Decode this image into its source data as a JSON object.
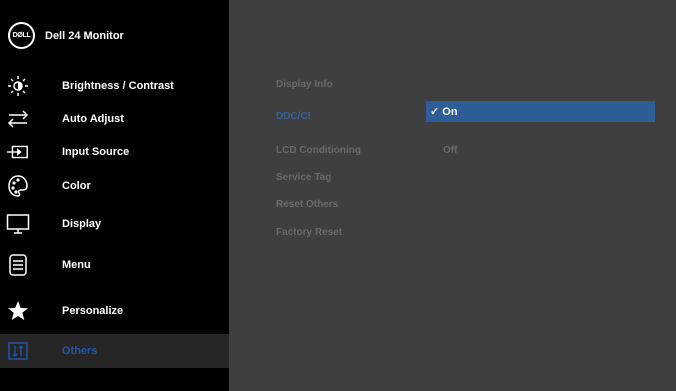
{
  "header": {
    "logo_text": "DØLL",
    "title": "Dell 24 Monitor"
  },
  "sidebar": {
    "items": [
      {
        "label": "Brightness / Contrast",
        "icon": "brightness-icon"
      },
      {
        "label": "Auto Adjust",
        "icon": "auto-adjust-icon"
      },
      {
        "label": "Input Source",
        "icon": "input-source-icon"
      },
      {
        "label": "Color",
        "icon": "color-palette-icon"
      },
      {
        "label": "Display",
        "icon": "display-icon"
      },
      {
        "label": "Menu",
        "icon": "menu-icon"
      },
      {
        "label": "Personalize",
        "icon": "star-icon"
      },
      {
        "label": "Others",
        "icon": "others-icon",
        "active": true
      }
    ]
  },
  "main": {
    "options": [
      {
        "label": "Display Info"
      },
      {
        "label": "DDC/CI",
        "selected": true
      },
      {
        "label": "LCD Conditioning"
      },
      {
        "label": "Service Tag"
      },
      {
        "label": "Reset Others"
      },
      {
        "label": "Factory Reset"
      }
    ],
    "ddc_values": {
      "on": "✓ On",
      "off": "Off"
    }
  },
  "colors": {
    "sidebar_bg": "#000000",
    "main_bg": "#3f3f3f",
    "highlight": "#2e5d97",
    "muted_text": "#6a6a6a"
  }
}
